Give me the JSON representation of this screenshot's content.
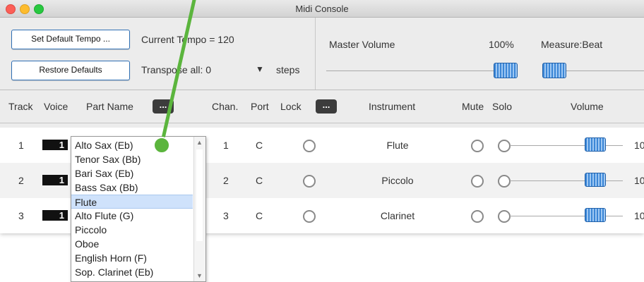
{
  "window": {
    "title": "Midi Console"
  },
  "toolbar": {
    "set_default_tempo": "Set Default Tempo ...",
    "restore_defaults": "Restore Defaults",
    "current_tempo": "Current Tempo =  120",
    "transpose_label": "Transpose all:  0",
    "transpose_arrow": "▼",
    "steps_label": "steps",
    "master_volume_label": "Master Volume",
    "master_volume_value": "100%",
    "master_volume_level": 1.0,
    "measure_beat_label": "Measure:Beat"
  },
  "header": {
    "track": "Track",
    "voice": "Voice",
    "part_name": "Part Name",
    "part_more": "...",
    "chan": "Chan.",
    "port": "Port",
    "lock": "Lock",
    "lock_more": "...",
    "instrument": "Instrument",
    "mute": "Mute",
    "solo": "Solo",
    "volume": "Volume"
  },
  "rows": [
    {
      "track": "1",
      "voice": "1",
      "chan": "1",
      "port": "C",
      "instrument": "Flute",
      "volume_tail": "10"
    },
    {
      "track": "2",
      "voice": "1",
      "chan": "2",
      "port": "C",
      "instrument": "Piccolo",
      "volume_tail": "10"
    },
    {
      "track": "3",
      "voice": "1",
      "chan": "3",
      "port": "C",
      "instrument": "Clarinet",
      "volume_tail": "10"
    }
  ],
  "dropdown": {
    "options": [
      "Alto Sax (Eb)",
      "Tenor Sax (Bb)",
      "Bari Sax (Eb)",
      "Bass Sax (Bb)",
      "Flute",
      "Alto Flute (G)",
      "Piccolo",
      "Oboe",
      "English Horn (F)",
      "Sop. Clarinet (Eb)"
    ],
    "selected_index": 4
  },
  "colors": {
    "annotation": "#5bb53d",
    "accent": "#2f6fb4",
    "close": "#fc5f57",
    "minimize": "#fdbc2e",
    "maximize": "#28c840"
  }
}
